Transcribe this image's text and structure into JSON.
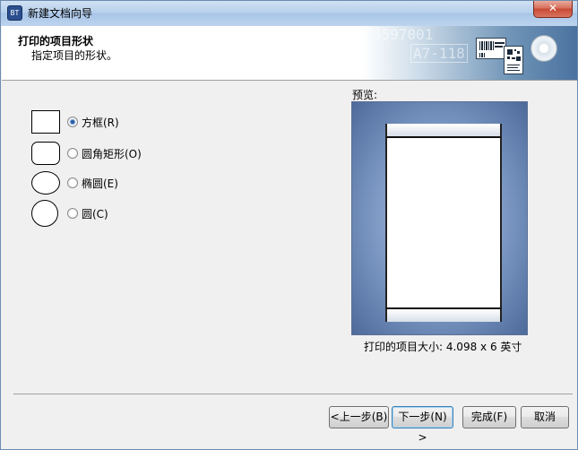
{
  "window": {
    "title": "新建文档向导",
    "app_icon_text": "BT",
    "close_symbol": "✕"
  },
  "header": {
    "title": "打印的项目形状",
    "subtitle": "指定项目的形状。",
    "graphic_text_1": "3597001",
    "graphic_text_2": "A7-118"
  },
  "shapes": {
    "options": [
      {
        "label": "方框(R)",
        "checked": true
      },
      {
        "label": "圆角矩形(O)",
        "checked": false
      },
      {
        "label": "椭圆(E)",
        "checked": false
      },
      {
        "label": "圆(C)",
        "checked": false
      }
    ]
  },
  "preview": {
    "label": "预览:",
    "size_text": "打印的项目大小:  4.098 x 6 英寸"
  },
  "buttons": {
    "back": "<上一步(B)",
    "next": "下一步(N) >",
    "finish": "完成(F)",
    "cancel": "取消"
  },
  "colors": {
    "preview_bg": "#7f9bc6",
    "accent": "#3c7fb1"
  }
}
